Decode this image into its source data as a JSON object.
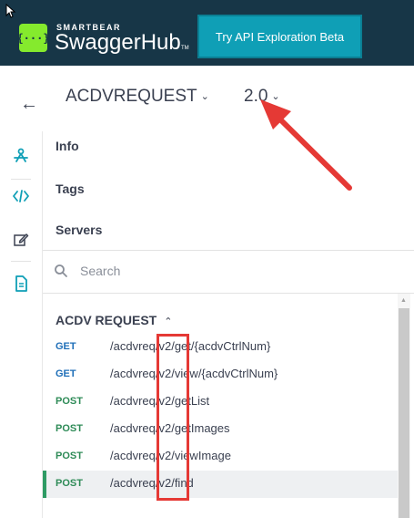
{
  "header": {
    "brand_small": "SMARTBEAR",
    "brand_big": "SwaggerHub",
    "brand_tm": "TM",
    "logo_glyph": "{···}",
    "try_button": "Try API Exploration Beta"
  },
  "titlebar": {
    "api_name": "ACDVREQUEST",
    "version": "2.0"
  },
  "nav": {
    "items": [
      "Info",
      "Tags",
      "Servers"
    ]
  },
  "search": {
    "placeholder": "Search"
  },
  "section": {
    "title": "ACDV REQUEST"
  },
  "endpoints": [
    {
      "method": "GET",
      "path": "/acdvreq/v2/get/{acdvCtrlNum}"
    },
    {
      "method": "GET",
      "path": "/acdvreq/v2/view/{acdvCtrlNum}"
    },
    {
      "method": "POST",
      "path": "/acdvreq/v2/getList"
    },
    {
      "method": "POST",
      "path": "/acdvreq/v2/getImages"
    },
    {
      "method": "POST",
      "path": "/acdvreq/v2/viewImage"
    },
    {
      "method": "POST",
      "path": "/acdvreq/v2/find"
    }
  ],
  "colors": {
    "header_bg": "#173647",
    "logo_green": "#85ea2d",
    "button_bg": "#0f9fb6",
    "get": "#1f6fb8",
    "post": "#2e8b57",
    "annotation_red": "#e53935"
  },
  "icons": {
    "rail": [
      "api-design-icon",
      "code-icon",
      "edit-icon",
      "document-icon"
    ],
    "back": "arrow-left-icon",
    "search": "search-icon"
  }
}
